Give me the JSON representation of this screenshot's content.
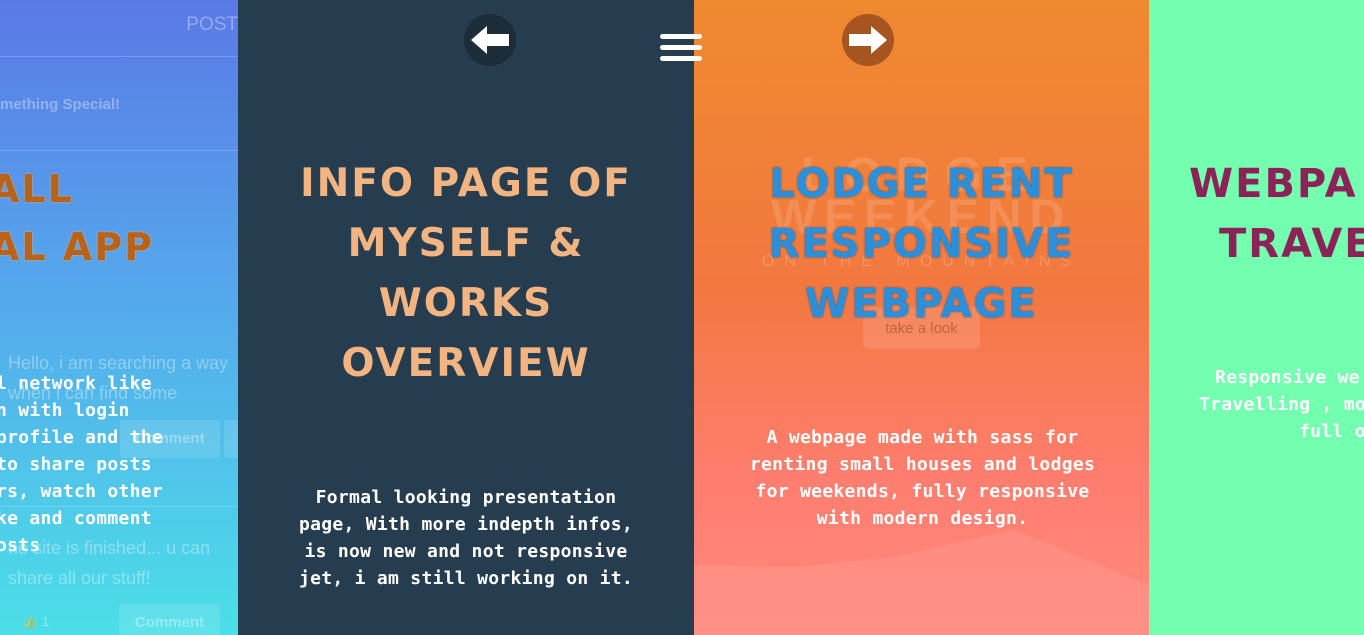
{
  "panels": [
    {
      "title_lines": [
        "ALL",
        "AL APP"
      ],
      "description_lines": [
        "l network like",
        "n with login",
        " profile and the",
        "to share posts",
        "rs, watch other",
        "ke and comment",
        "osts"
      ],
      "background": {
        "post_label": "POST",
        "special_text": "mething Special!",
        "hello_lines": [
          "Hello, i am searching a way",
          "when i can find some"
        ],
        "comment_label": "Comment",
        "finished_lines": [
          "he site is finished... u can",
          "share all our stuff!"
        ],
        "like_count": "1",
        "comment_label_2": "Comment"
      }
    },
    {
      "title_lines": [
        "INFO PAGE OF",
        "MYSELF &",
        "WORKS",
        "OVERVIEW"
      ],
      "description_lines": [
        "Formal looking presentation",
        "page, With more indepth infos,",
        "is now new and not responsive",
        "jet, i am still working on it."
      ]
    },
    {
      "title_lines": [
        "LODGE RENT",
        "RESPONSIVE",
        "WEBPAGE"
      ],
      "description_lines": [
        "A webpage made with sass for",
        "renting small houses and lodges",
        "for weekends, fully responsive",
        "with modern design."
      ],
      "background": {
        "ghost_line1": "LODGE",
        "ghost_line2": "WEEKEND",
        "ghost_line3": "ON THE MOUNTAINS",
        "button_label": "take a look"
      }
    },
    {
      "title_lines": [
        "WEBPA",
        "TRAVE"
      ],
      "description_lines": [
        "Responsive we",
        "Travelling , mo",
        "full o"
      ]
    }
  ],
  "nav": {
    "prev_icon": "arrow-left-icon",
    "next_icon": "arrow-right-icon",
    "menu_icon": "hamburger-menu-icon"
  },
  "colors": {
    "panel2_bg": "#263c4f",
    "title_peach": "#f2b582",
    "title_blue": "#2b8fd9",
    "title_magenta": "#8c2358",
    "panel4_bg": "#74ffb0"
  }
}
